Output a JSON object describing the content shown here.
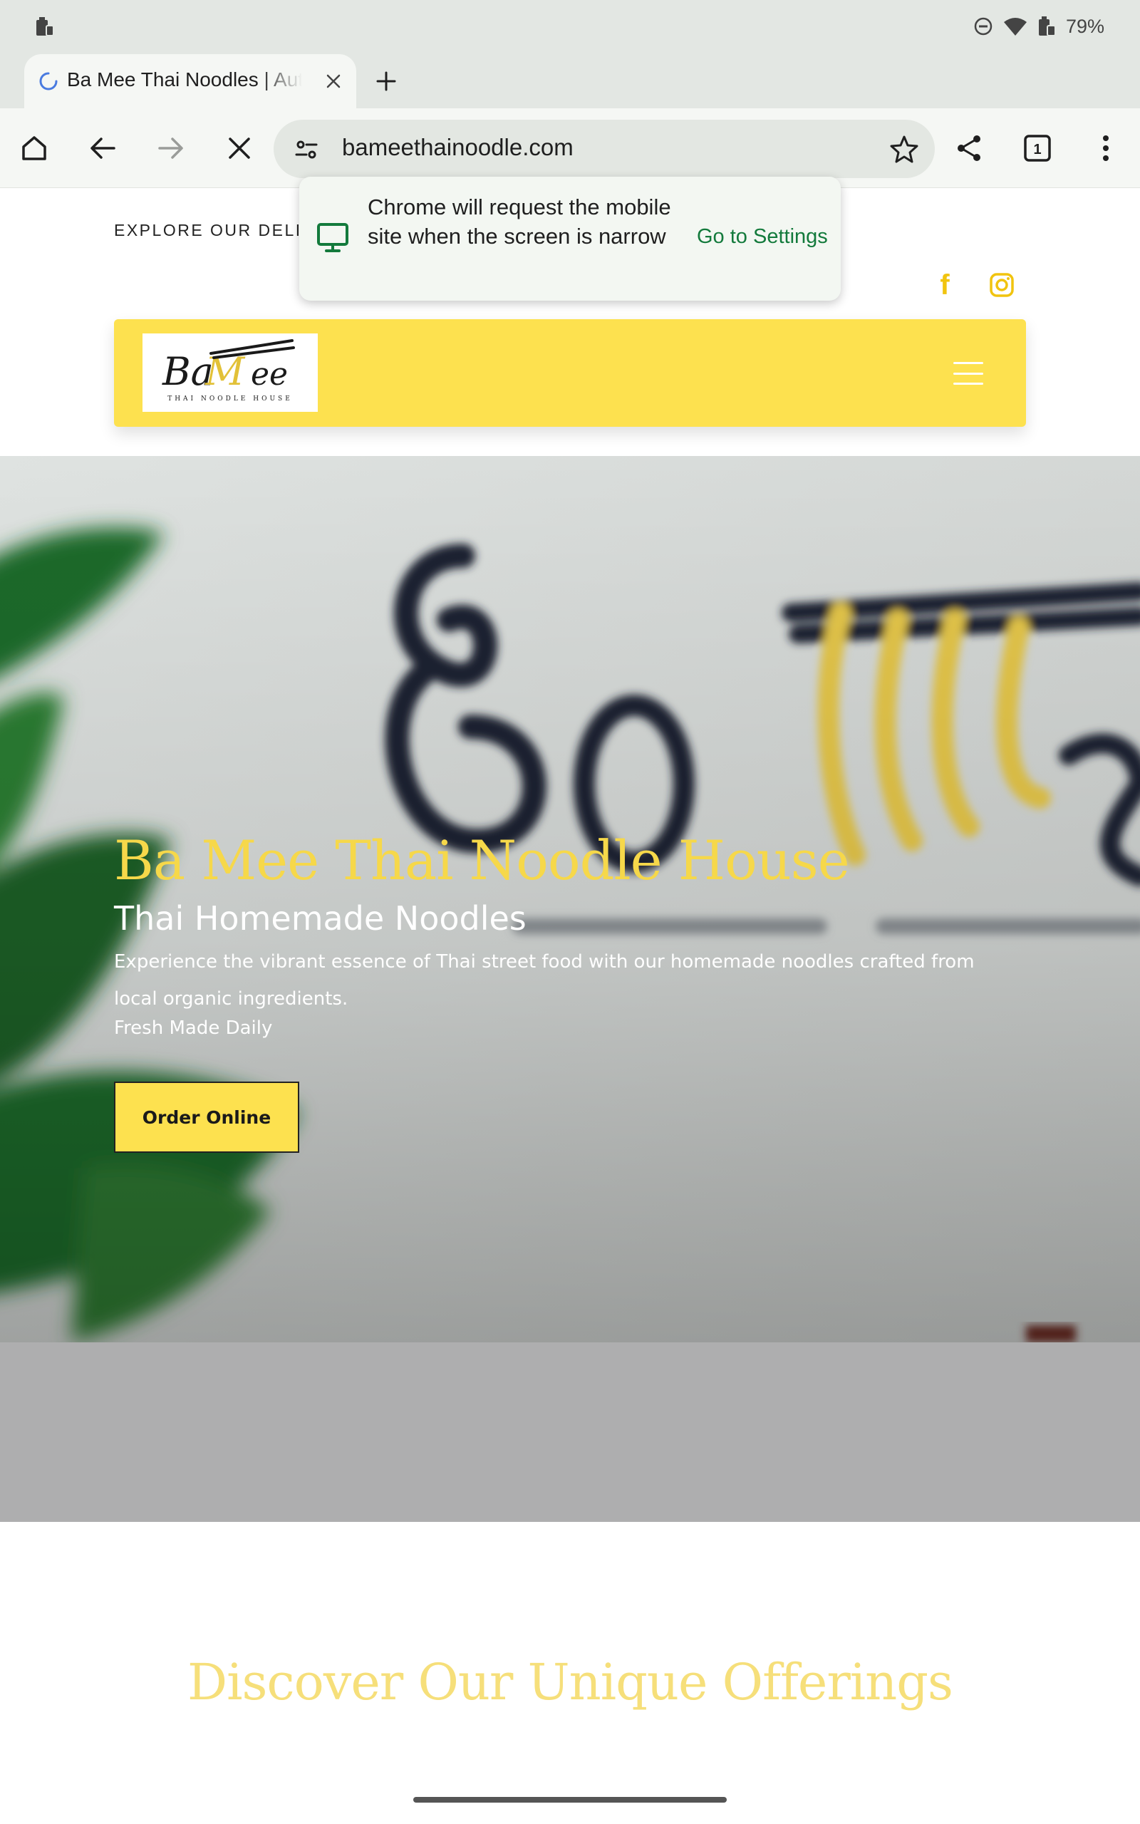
{
  "status_bar": {
    "battery_percent": "79%"
  },
  "tab": {
    "title": "Ba Mee Thai Noodles | Authentic Thai"
  },
  "toolbar": {
    "url": "bameethainoodle.com",
    "tab_count": "1"
  },
  "popup": {
    "message": "Chrome will request the mobile site when the screen is narrow",
    "action": "Go to Settings"
  },
  "site": {
    "explore_text": "EXPLORE OUR DELICIOUS",
    "logo": {
      "wordmark": "BaMee",
      "tagline": "THAI NOODLE HOUSE"
    },
    "hero": {
      "title": "Ba Mee Thai Noodle House",
      "subtitle": "Thai Homemade Noodles",
      "description": "Experience the vibrant essence of Thai street food with our homemade noodles crafted from local organic ingredients.",
      "fresh": "Fresh Made Daily",
      "button": "Order Online"
    },
    "section_title": "Discover Our Unique Offerings"
  },
  "colors": {
    "brand_yellow": "#fde14f",
    "title_yellow": "#f6d84a",
    "chrome_green": "#137a3c"
  },
  "icons": [
    "battery-icon",
    "dnd-icon",
    "wifi-icon",
    "tab-spinner-icon",
    "close-icon",
    "plus-icon",
    "home-icon",
    "back-icon",
    "forward-icon",
    "stop-icon",
    "site-settings-icon",
    "star-icon",
    "share-icon",
    "tab-switcher-icon",
    "more-vert-icon",
    "desktop-icon",
    "facebook-icon",
    "instagram-icon",
    "hamburger-icon"
  ]
}
